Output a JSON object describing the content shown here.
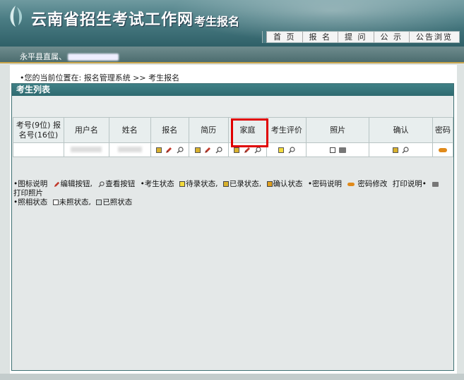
{
  "header": {
    "title": "云南省招生考试工作网",
    "subtitle": "考生报名"
  },
  "nav": {
    "items": [
      "首 页",
      "报 名",
      "提 问",
      "公 示",
      "公告浏览"
    ]
  },
  "strip": {
    "unit_text": "永平县直属、"
  },
  "breadcrumb": "•您的当前位置在: 报名管理系统 >> 考生报名",
  "panel": {
    "title": "考生列表"
  },
  "table": {
    "headers": [
      "考号(9位) 报名号(16位)",
      "用户名",
      "姓名",
      "报名",
      "简历",
      "家庭",
      "考生评价",
      "照片",
      "确认",
      "密码"
    ]
  },
  "legend": {
    "line1": [
      "•图标说明",
      "编辑按钮,",
      "查看按钮",
      "•考生状态",
      "待录状态,",
      "已录状态,",
      "确认状态",
      "•密码说明",
      "密码修改",
      "打印说明•",
      "打印照片"
    ],
    "line2": [
      "•照相状态",
      "未照状态,",
      "已照状态"
    ]
  },
  "colors": {
    "header_bg": "#4b7d84",
    "panel_title_bg": "#2f6a70",
    "highlight": "#e00000",
    "accent_line": "#c9a54a"
  }
}
